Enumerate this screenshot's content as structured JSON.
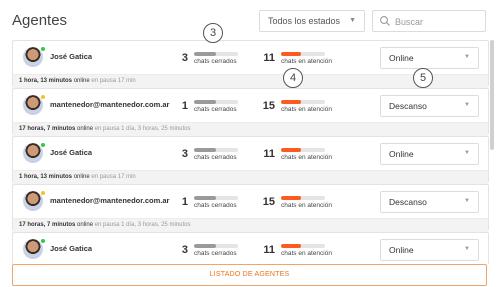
{
  "header": {
    "title": "Agentes",
    "status_filter": "Todos los estados",
    "search_placeholder": "Buscar"
  },
  "colors": {
    "online": "#2ecc40",
    "away": "#f5c518",
    "closed_bar": "#9a9a9a",
    "attention_bar": "#ff5a1f",
    "accent": "#e97321"
  },
  "agents": [
    {
      "name": "José Gatica",
      "status_color": "online",
      "chats_closed": "3",
      "chats_closed_label": "chats cerrados",
      "chats_closed_fill": 0.5,
      "chats_attention": "11",
      "chats_attention_label": "chats en atención",
      "chats_attention_fill": 0.45,
      "state": "Online",
      "online_time": "1 hora, 13 minutos",
      "online_word": "online",
      "pause_text": "en pausa 17 min"
    },
    {
      "name": "mantenedor@mantenedor.com.ar",
      "status_color": "away",
      "chats_closed": "1",
      "chats_closed_label": "chats cerrados",
      "chats_closed_fill": 0.5,
      "chats_attention": "15",
      "chats_attention_label": "chats en atención",
      "chats_attention_fill": 0.45,
      "state": "Descanso",
      "online_time": "17 horas, 7 minutos",
      "online_word": "online",
      "pause_text": "en pausa 1 día, 3 horas, 25 minutos"
    },
    {
      "name": "José Gatica",
      "status_color": "online",
      "chats_closed": "3",
      "chats_closed_label": "chats cerrados",
      "chats_closed_fill": 0.5,
      "chats_attention": "11",
      "chats_attention_label": "chats en atención",
      "chats_attention_fill": 0.45,
      "state": "Online",
      "online_time": "1 hora, 13 minutos",
      "online_word": "online",
      "pause_text": "en pausa 17 min"
    },
    {
      "name": "mantenedor@mantenedor.com.ar",
      "status_color": "away",
      "chats_closed": "1",
      "chats_closed_label": "chats cerrados",
      "chats_closed_fill": 0.5,
      "chats_attention": "15",
      "chats_attention_label": "chats en atención",
      "chats_attention_fill": 0.45,
      "state": "Descanso",
      "online_time": "17 horas, 7 minutos",
      "online_word": "online",
      "pause_text": "en pausa 1 día, 3 horas, 25 minutos"
    },
    {
      "name": "José Gatica",
      "status_color": "online",
      "chats_closed": "3",
      "chats_closed_label": "chats cerrados",
      "chats_closed_fill": 0.5,
      "chats_attention": "11",
      "chats_attention_label": "chats en atención",
      "chats_attention_fill": 0.45,
      "state": "Online",
      "online_time": "",
      "online_word": "",
      "pause_text": ""
    }
  ],
  "markers": [
    "3",
    "4",
    "5"
  ],
  "footer": {
    "button_label": "LISTADO DE AGENTES"
  }
}
